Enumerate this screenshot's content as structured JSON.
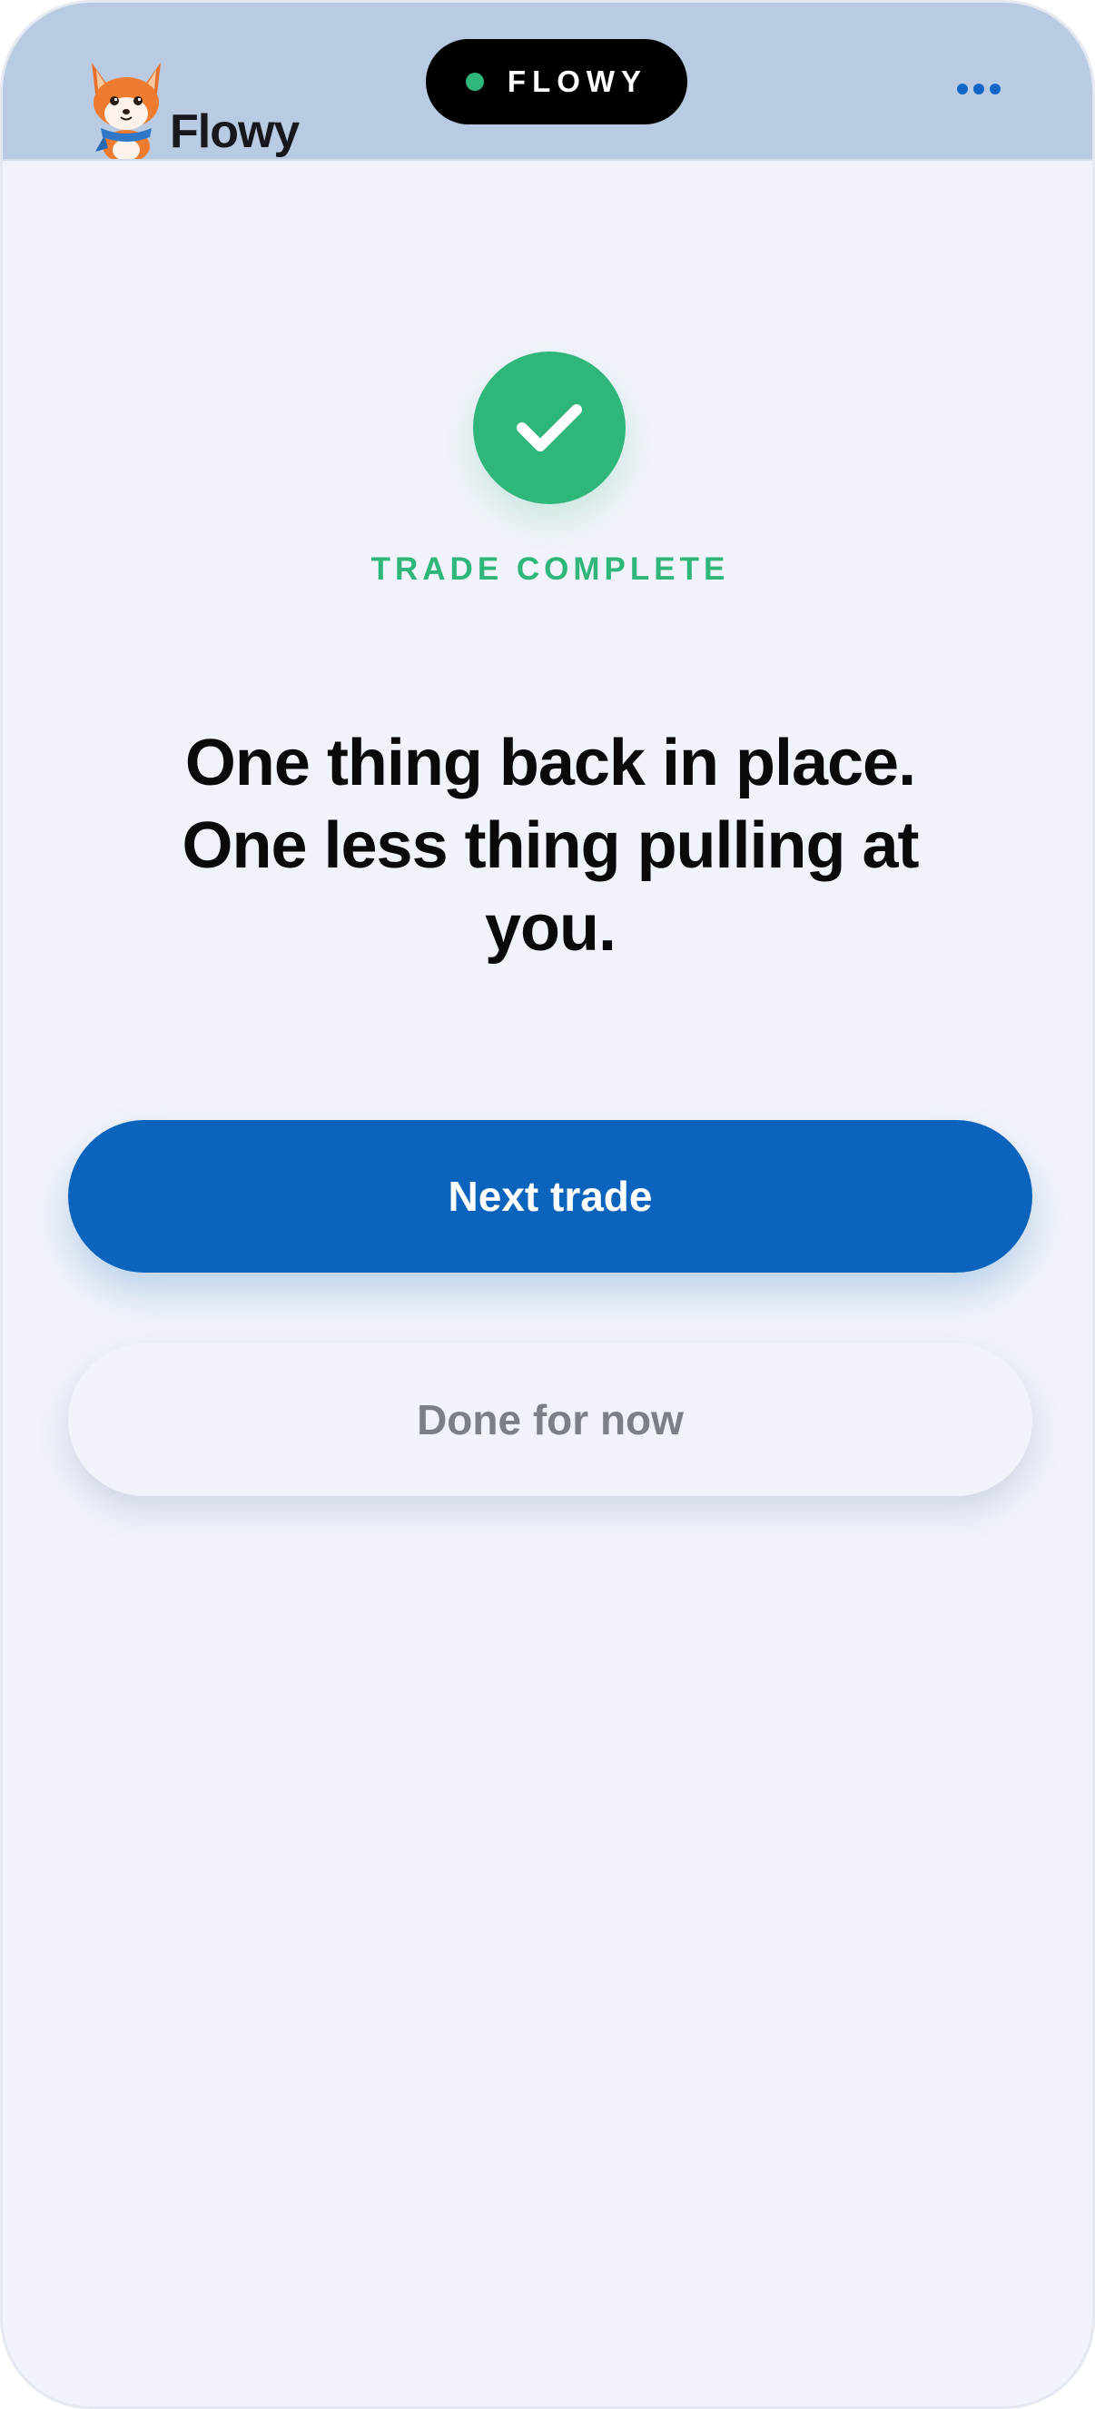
{
  "app": {
    "brand_name": "Flowy",
    "status_label": "FLOWY",
    "status_color": "#2fb67b"
  },
  "header": {
    "logo_icon": "fox-mascot-icon",
    "menu_icon": "more-horizontal-icon"
  },
  "result": {
    "icon": "checkmark-icon",
    "eyebrow": "TRADE COMPLETE",
    "headline": "One thing back in place. One less thing pulling at you."
  },
  "actions": {
    "primary_label": "Next trade",
    "secondary_label": "Done for now"
  },
  "colors": {
    "accent_green": "#2fb67b",
    "primary_blue": "#0b63bb",
    "header_bg": "#b9cbe2",
    "page_bg": "#f0f3f9"
  }
}
